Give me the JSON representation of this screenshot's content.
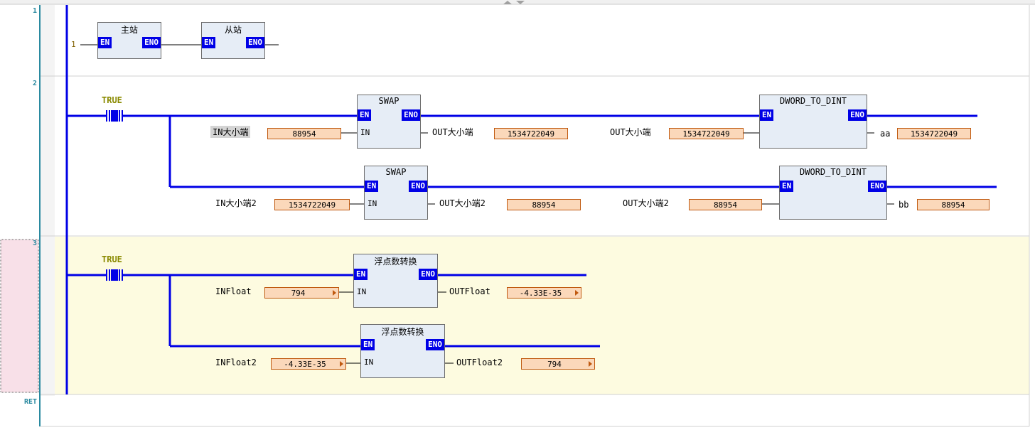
{
  "rungs": [
    {
      "num": "1"
    },
    {
      "num": "2"
    },
    {
      "num": "3"
    },
    {
      "num": "RET"
    }
  ],
  "rung1": {
    "input_const": "1",
    "blocks": [
      {
        "title": "主站",
        "en": "EN",
        "eno": "ENO"
      },
      {
        "title": "从站",
        "en": "EN",
        "eno": "ENO"
      }
    ]
  },
  "rung2": {
    "contact": "TRUE",
    "branch1": {
      "swap": {
        "title": "SWAP",
        "en": "EN",
        "eno": "ENO",
        "in": "IN"
      },
      "in_label": "IN大小端",
      "in_value": "88954",
      "out_label": "OUT大小端",
      "out_value": "1534722049",
      "conv": {
        "title": "DWORD_TO_DINT",
        "en": "EN",
        "eno": "ENO"
      },
      "conv_in_label": "OUT大小端",
      "conv_in_value": "1534722049",
      "conv_out_label": "aa",
      "conv_out_value": "1534722049"
    },
    "branch2": {
      "swap": {
        "title": "SWAP",
        "en": "EN",
        "eno": "ENO",
        "in": "IN"
      },
      "in_label": "IN大小端2",
      "in_value": "1534722049",
      "out_label": "OUT大小端2",
      "out_value": "88954",
      "conv": {
        "title": "DWORD_TO_DINT",
        "en": "EN",
        "eno": "ENO"
      },
      "conv_in_label": "OUT大小端2",
      "conv_in_value": "88954",
      "conv_out_label": "bb",
      "conv_out_value": "88954"
    }
  },
  "rung3": {
    "contact": "TRUE",
    "branch1": {
      "block": {
        "title": "浮点数转换",
        "en": "EN",
        "eno": "ENO",
        "in": "IN"
      },
      "in_label": "INFloat",
      "in_value": "794",
      "out_label": "OUTFloat",
      "out_value": "-4.33E-35"
    },
    "branch2": {
      "block": {
        "title": "浮点数转换",
        "en": "EN",
        "eno": "ENO",
        "in": "IN"
      },
      "in_label": "INFloat2",
      "in_value": "-4.33E-35",
      "out_label": "OUTFloat2",
      "out_value": "794"
    }
  },
  "colors": {
    "power_rail": "#0000e6",
    "rung_highlight": "#fdfbe0",
    "selection": "#f8e0e8",
    "var_box": "#fbd8ba"
  }
}
